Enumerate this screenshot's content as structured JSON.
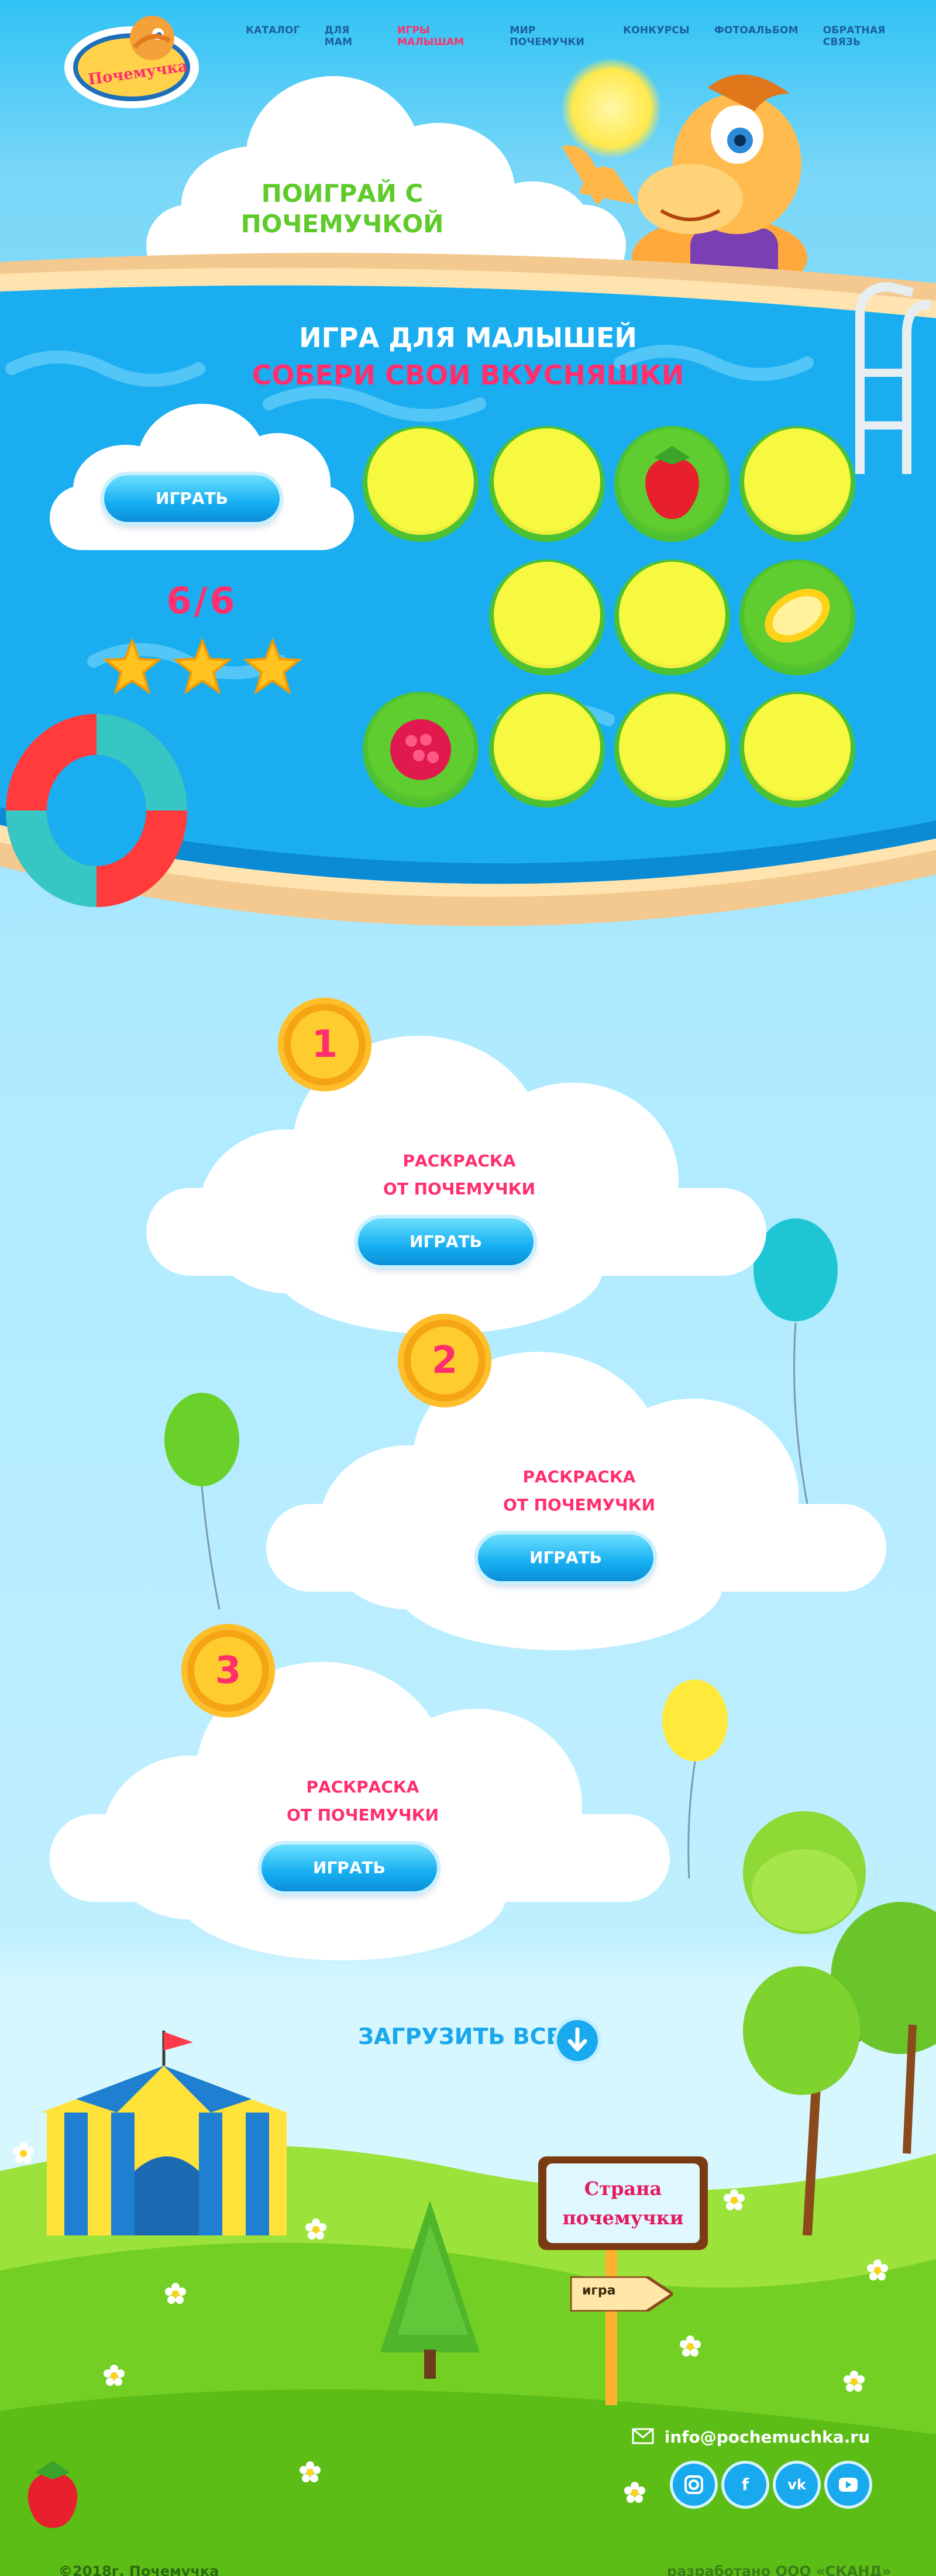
{
  "header": {
    "logo_text": "Почемучка",
    "nav": [
      {
        "label": "Каталог",
        "active": false
      },
      {
        "label": "Для мам",
        "active": false
      },
      {
        "label": "Игры малышам",
        "active": true
      },
      {
        "label": "Мир почемучки",
        "active": false
      },
      {
        "label": "Конкурсы",
        "active": false
      },
      {
        "label": "Фотоальбом",
        "active": false
      },
      {
        "label": "Обратная связь",
        "active": false
      }
    ]
  },
  "hero": {
    "title_line1": "Поиграй с",
    "title_line2": "почемучкой"
  },
  "game": {
    "title_line1": "Игра для малышей",
    "title_line2": "Собери свои вкусняшки",
    "play_label": "Играть",
    "score": "6/6",
    "stars": 3,
    "tiles": [
      [
        "closed",
        "closed",
        "strawberry",
        "closed"
      ],
      [
        "empty",
        "closed",
        "closed",
        "lemon"
      ],
      [
        "raspberry",
        "closed",
        "closed",
        "closed"
      ]
    ]
  },
  "cards": [
    {
      "number": "1",
      "title_line1": "Раскраска",
      "title_line2": "от почемучки",
      "button": "Играть"
    },
    {
      "number": "2",
      "title_line1": "Раскраска",
      "title_line2": "от почемучки",
      "button": "Играть"
    },
    {
      "number": "3",
      "title_line1": "Раскраска",
      "title_line2": "от почемучки",
      "button": "Играть"
    }
  ],
  "load_all": "Загрузить все",
  "scene": {
    "sign_line1": "Страна",
    "sign_line2": "почемучки",
    "arrow_label": "игра"
  },
  "footer": {
    "email": "info@pochemuchka.ru",
    "social": [
      "instagram-icon",
      "facebook-icon",
      "vk-icon",
      "youtube-icon"
    ],
    "copyright": "©2018г. Почемучка",
    "developer": "разработано ООО «СКАНД»"
  },
  "colors": {
    "accent_pink": "#ff2f6e",
    "title_green": "#5ecb2a",
    "button_blue": "#16aef1",
    "tile_yellow": "#f7f941",
    "tile_green": "#4cc233"
  }
}
